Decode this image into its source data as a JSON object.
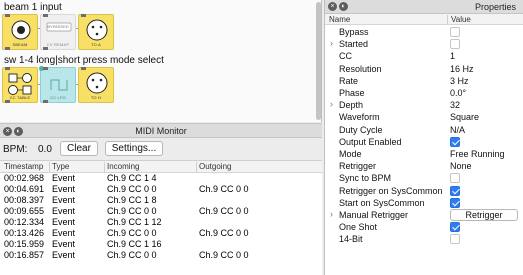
{
  "patcher": {
    "comment_1": "beam 1 input",
    "comment_2": "sw 1-4 long|short press mode select",
    "nodes": [
      {
        "caption": "SBEAM"
      },
      {
        "caption": "BYPASSED"
      },
      {
        "caption": "CV REMAP"
      },
      {
        "caption": "TO A"
      },
      {
        "caption": "CC TABLE"
      },
      {
        "caption": "CC LFO"
      },
      {
        "caption": "TO H"
      }
    ]
  },
  "midi_monitor": {
    "title": "MIDI Monitor",
    "bpm_label": "BPM:",
    "bpm_value": "0.0",
    "clear_label": "Clear",
    "settings_label": "Settings...",
    "columns": [
      "Timestamp",
      "Type",
      "Incoming",
      "Outgoing"
    ],
    "rows": [
      {
        "timestamp": "00:02.968",
        "type": "Event",
        "incoming": "Ch.9 CC 1 4",
        "outgoing": ""
      },
      {
        "timestamp": "00:04.691",
        "type": "Event",
        "incoming": "Ch.9 CC 0 0",
        "outgoing": "Ch.9 CC 0 0"
      },
      {
        "timestamp": "00:08.397",
        "type": "Event",
        "incoming": "Ch.9 CC 1 8",
        "outgoing": ""
      },
      {
        "timestamp": "00:09.655",
        "type": "Event",
        "incoming": "Ch.9 CC 0 0",
        "outgoing": "Ch.9 CC 0 0"
      },
      {
        "timestamp": "00:12.334",
        "type": "Event",
        "incoming": "Ch.9 CC 1 12",
        "outgoing": ""
      },
      {
        "timestamp": "00:13.426",
        "type": "Event",
        "incoming": "Ch.9 CC 0 0",
        "outgoing": "Ch.9 CC 0 0"
      },
      {
        "timestamp": "00:15.959",
        "type": "Event",
        "incoming": "Ch.9 CC 1 16",
        "outgoing": ""
      },
      {
        "timestamp": "00:16.857",
        "type": "Event",
        "incoming": "Ch.9 CC 0 0",
        "outgoing": "Ch.9 CC 0 0"
      }
    ]
  },
  "properties": {
    "title": "Properties",
    "columns": [
      "Name",
      "Value"
    ],
    "rows": [
      {
        "name": "Bypass",
        "kind": "checkbox",
        "checked": false,
        "expandable": false
      },
      {
        "name": "Started",
        "kind": "checkbox",
        "checked": false,
        "expandable": true
      },
      {
        "name": "CC",
        "kind": "text",
        "value": "1",
        "expandable": false
      },
      {
        "name": "Resolution",
        "kind": "text",
        "value": "16 Hz",
        "expandable": false
      },
      {
        "name": "Rate",
        "kind": "text",
        "value": "3 Hz",
        "expandable": false
      },
      {
        "name": "Phase",
        "kind": "text",
        "value": "0.0°",
        "expandable": false
      },
      {
        "name": "Depth",
        "kind": "text",
        "value": "32",
        "expandable": true
      },
      {
        "name": "Waveform",
        "kind": "text",
        "value": "Square",
        "expandable": false
      },
      {
        "name": "Duty Cycle",
        "kind": "text",
        "value": "N/A",
        "expandable": false
      },
      {
        "name": "Output Enabled",
        "kind": "checkbox",
        "checked": true,
        "expandable": false
      },
      {
        "name": "Mode",
        "kind": "text",
        "value": "Free Running",
        "expandable": false
      },
      {
        "name": "Retrigger",
        "kind": "text",
        "value": "None",
        "expandable": false
      },
      {
        "name": "Sync to BPM",
        "kind": "checkbox",
        "checked": false,
        "expandable": false
      },
      {
        "name": "Retrigger on SysCommon",
        "kind": "checkbox",
        "checked": true,
        "expandable": false
      },
      {
        "name": "Start on SysCommon",
        "kind": "checkbox",
        "checked": true,
        "expandable": false
      },
      {
        "name": "Manual Retrigger",
        "kind": "button",
        "value": "Retrigger",
        "expandable": true
      },
      {
        "name": "One Shot",
        "kind": "checkbox",
        "checked": true,
        "expandable": false
      },
      {
        "name": "14-Bit",
        "kind": "checkbox",
        "checked": false,
        "expandable": false
      }
    ]
  }
}
